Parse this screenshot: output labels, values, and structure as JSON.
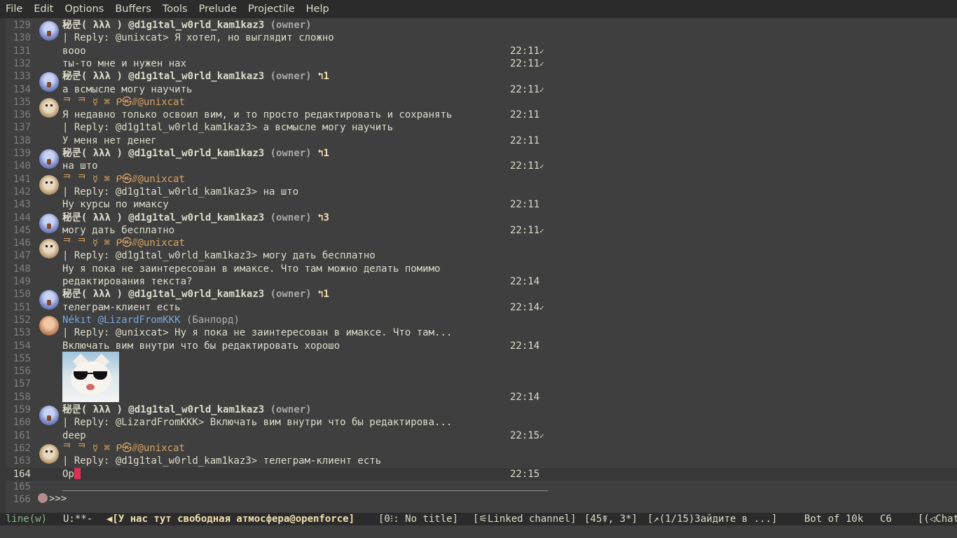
{
  "menubar": [
    "File",
    "Edit",
    "Options",
    "Buffers",
    "Tools",
    "Prelude",
    "Projectile",
    "Help"
  ],
  "lines": [
    {
      "n": "129",
      "kind": "header",
      "author": "秘쿤( λλλ ) @d1g1tal_w0rld_kam1kaz3",
      "role": "(owner)",
      "avatar": "lambda"
    },
    {
      "n": "130",
      "text": "| Reply: @unixcat> Я хотел, но выглядит сложно"
    },
    {
      "n": "131",
      "text": "вооо",
      "ts": "22:11",
      "check": "✓"
    },
    {
      "n": "132",
      "text": "ты-то мне и нужен нах",
      "ts": "22:11",
      "check": "✓"
    },
    {
      "n": "133",
      "kind": "header",
      "author": "秘쿤( λλλ ) @d1g1tal_w0rld_kam1kaz3",
      "role": "(owner)",
      "badge": "↰1",
      "avatar": "lambda"
    },
    {
      "n": "134",
      "text": "а всмысле могу научить",
      "ts": "22:11",
      "check": "✓"
    },
    {
      "n": "135",
      "kind": "orange",
      "author": "ᄏ ᄏ ☿ ⌘ ᑭ㉿⫻@unixcat",
      "avatar": "dog"
    },
    {
      "n": "136",
      "text": "Я недавно только освоил вим, и то просто редактировать и сохранять",
      "ts": "22:11"
    },
    {
      "n": "137",
      "text": "| Reply: @d1g1tal_w0rld_kam1kaz3> а всмысле могу научить"
    },
    {
      "n": "138",
      "text": "У меня нет денег",
      "ts": "22:11"
    },
    {
      "n": "139",
      "kind": "header",
      "author": "秘쿤( λλλ ) @d1g1tal_w0rld_kam1kaz3",
      "role": "(owner)",
      "badge": "↰1",
      "avatar": "lambda"
    },
    {
      "n": "140",
      "text": "на што",
      "ts": "22:11",
      "check": "✓"
    },
    {
      "n": "141",
      "kind": "orange",
      "author": "ᄏ ᄏ ☿ ⌘ ᑭ㉿⫻@unixcat",
      "avatar": "dog"
    },
    {
      "n": "142",
      "text": "| Reply: @d1g1tal_w0rld_kam1kaz3> на што"
    },
    {
      "n": "143",
      "text": "Ну курсы по имаксу",
      "ts": "22:11"
    },
    {
      "n": "144",
      "kind": "header",
      "author": "秘쿤( λλλ ) @d1g1tal_w0rld_kam1kaz3",
      "role": "(owner)",
      "badge": "↰3",
      "avatar": "lambda"
    },
    {
      "n": "145",
      "text": "могу дать бесплатно",
      "ts": "22:11",
      "check": "✓"
    },
    {
      "n": "146",
      "kind": "orange",
      "author": "ᄏ ᄏ ☿ ⌘ ᑭ㉿⫻@unixcat",
      "avatar": "dog"
    },
    {
      "n": "147",
      "text": "| Reply: @d1g1tal_w0rld_kam1kaz3> могу дать бесплатно"
    },
    {
      "n": "148",
      "text": "Ну я пока не заинтересован в имаксе. Что там можно делать помимо"
    },
    {
      "n": "149",
      "text": "редактирования текста?",
      "ts": "22:14"
    },
    {
      "n": "150",
      "kind": "header",
      "author": "秘쿤( λλλ ) @d1g1tal_w0rld_kam1kaz3",
      "role": "(owner)",
      "badge": "↰1",
      "avatar": "lambda"
    },
    {
      "n": "151",
      "text": "телеграм-клиент есть",
      "ts": "22:14",
      "check": "✓"
    },
    {
      "n": "152",
      "kind": "blue",
      "author": "Nékıt @LizardFromKKK",
      "role": "(Банлорд)",
      "avatar": "nekit"
    },
    {
      "n": "153",
      "text": "| Reply: @unixcat> Ну я пока не заинтересован в имаксе. Что там..."
    },
    {
      "n": "154",
      "text": "Включать вим внутри что бы редактировать хорошо",
      "ts": "22:14"
    },
    {
      "n": "155",
      "text": ""
    },
    {
      "n": "156",
      "text": ""
    },
    {
      "n": "157",
      "text": ""
    },
    {
      "n": "158",
      "text": "",
      "ts": "22:14"
    },
    {
      "n": "159",
      "kind": "header",
      "author": "秘쿤( λλλ ) @d1g1tal_w0rld_kam1kaz3",
      "role": "(owner)",
      "avatar": "lambda"
    },
    {
      "n": "160",
      "text": "| Reply: @LizardFromKKK> Включать вим внутри что бы редактирова..."
    },
    {
      "n": "161",
      "text": "deep",
      "ts": "22:15",
      "check": "✓"
    },
    {
      "n": "162",
      "kind": "orange",
      "author": "ᄏ ᄏ ☿ ⌘ ᑭ㉿⫻@unixcat",
      "avatar": "dog"
    },
    {
      "n": "163",
      "text": "| Reply: @d1g1tal_w0rld_kam1kaz3> телеграм-клиент есть"
    },
    {
      "n": "164",
      "text": "Op",
      "ts": "22:15",
      "current": true
    },
    {
      "n": "165",
      "text": ""
    },
    {
      "n": "166",
      "text": ""
    }
  ],
  "prompt": ">>>",
  "modeline": {
    "mode": "line(w)",
    "state": "U:**-",
    "buffer": "◀[У нас тут свободная атмосфера@openforce]",
    "segment1": "[0⁝: No title]",
    "segment2": "[⚟Linked channel]",
    "segment3": "[45☤, 3*]",
    "segment4": "[↗(1/15)Зайдите в ...]",
    "position": "Bot of 10k",
    "column": "C6",
    "tail": "[(◁Chat"
  },
  "colors": {
    "background": "#3f3f3f",
    "foreground": "#dcdccc",
    "orange_author": "#d9a35f",
    "blue_author": "#7aa6da",
    "cursor": "#dc3052"
  }
}
